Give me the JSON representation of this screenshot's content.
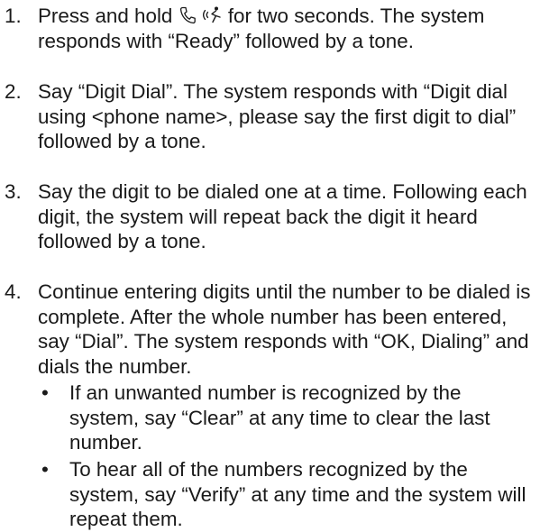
{
  "steps": [
    {
      "num": "1.",
      "before_icons": "Press and hold ",
      "icons": [
        "phone-icon",
        "voice-icon"
      ],
      "after_icons": " for two seconds. The system responds with “Ready” followed by a tone."
    },
    {
      "num": "2.",
      "text": "Say “Digit Dial”. The system responds with “Digit dial using <phone name>, please say the first digit to dial” followed by a tone."
    },
    {
      "num": "3.",
      "text": "Say the digit to be dialed one at a time. Following each digit, the system will repeat back the digit it heard followed by a tone."
    },
    {
      "num": "4.",
      "text": "Continue entering digits until the number to be dialed is complete. After the whole number has been entered, say “Dial”. The system responds with “OK, Dialing” and dials the number."
    }
  ],
  "bullets": [
    {
      "mark": "•",
      "text": "If an unwanted number is recognized by the system, say “Clear” at any time to clear the last number."
    },
    {
      "mark": "•",
      "text": "To hear all of the numbers recognized by the system, say “Verify” at any time and the system will repeat them."
    }
  ]
}
